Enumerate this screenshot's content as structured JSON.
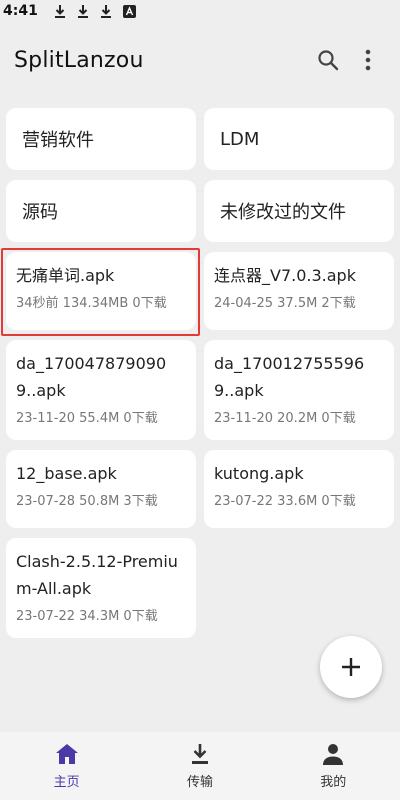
{
  "status_bar": {
    "time": "4:41"
  },
  "app_bar": {
    "title": "SplitLanzou"
  },
  "folders": [
    {
      "name": "营销软件"
    },
    {
      "name": "LDM"
    },
    {
      "name": "源码"
    },
    {
      "name": "未修改过的文件"
    }
  ],
  "files": [
    {
      "name": "无痛单词.apk",
      "meta": "34秒前 134.34MB 0下载"
    },
    {
      "name": "连点器_V7.0.3.apk",
      "meta": "24-04-25 37.5M 2下载"
    },
    {
      "name": "da_1700478790909..apk",
      "meta": "23-11-20 55.4M 0下载"
    },
    {
      "name": "da_1700127555969..apk",
      "meta": "23-11-20 20.2M 0下载"
    },
    {
      "name": "12_base.apk",
      "meta": "23-07-28 50.8M 3下载"
    },
    {
      "name": "kutong.apk",
      "meta": "23-07-22 33.6M 0下载"
    },
    {
      "name": "Clash-2.5.12-Premium-All.apk",
      "meta": "23-07-22 34.3M 0下载"
    }
  ],
  "bottom_nav": [
    {
      "label": "主页",
      "active": true
    },
    {
      "label": "传输",
      "active": false
    },
    {
      "label": "我的",
      "active": false
    }
  ],
  "colors": {
    "accent": "#4a3aa6",
    "highlight": "#e53935"
  }
}
